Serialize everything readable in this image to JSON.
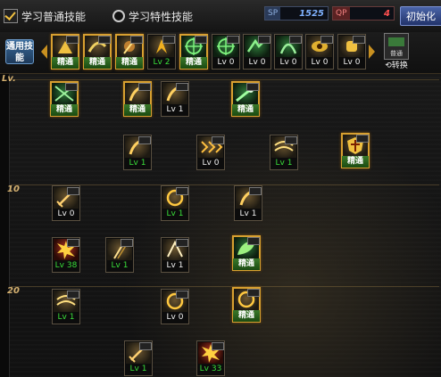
{
  "tabs": [
    {
      "label": "学习普通技能",
      "selected": true
    },
    {
      "label": "学习特性技能",
      "selected": false
    }
  ],
  "points": {
    "sp": {
      "label": "SP",
      "value": "1525"
    },
    "qp": {
      "label": "QP",
      "value": "4"
    }
  },
  "init_button": "初始化",
  "common": {
    "label": "通用技能",
    "items": [
      {
        "caption": "精通",
        "kind": "master",
        "icon": "strike-icon"
      },
      {
        "caption": "精通",
        "kind": "master",
        "icon": "kick-icon"
      },
      {
        "caption": "精通",
        "kind": "master",
        "icon": "throw-icon"
      },
      {
        "caption": "Lv 2",
        "kind": "lv",
        "icon": "phoenix-icon"
      },
      {
        "caption": "精通",
        "kind": "master",
        "icon": "crosshair-icon",
        "color": "green"
      },
      {
        "caption": "Lv 0",
        "kind": "lvw",
        "icon": "crosshair-icon",
        "color": "green"
      },
      {
        "caption": "Lv 0",
        "kind": "lvw",
        "icon": "dash-icon",
        "color": "green"
      },
      {
        "caption": "Lv 0",
        "kind": "lvw",
        "icon": "leap-icon",
        "color": "green"
      },
      {
        "caption": "Lv 0",
        "kind": "lvw",
        "icon": "eye-icon"
      },
      {
        "caption": "Lv 0",
        "kind": "lvw",
        "icon": "fist-icon"
      }
    ],
    "switch": {
      "box_label": "普通",
      "label": "转换"
    }
  },
  "level_labels": [
    "Lv.",
    "10",
    "20"
  ],
  "tree": [
    {
      "caption": "精通",
      "kind": "master",
      "icon": "grid-icon",
      "color": "green"
    },
    {
      "caption": "精通",
      "kind": "master",
      "icon": "slash-icon"
    },
    {
      "caption": "Lv 1",
      "kind": "lvw",
      "icon": "slash-icon"
    },
    {
      "caption": "精通",
      "kind": "master",
      "icon": "lunge-icon",
      "color": "green"
    },
    {
      "caption": "Lv 1",
      "kind": "lv",
      "icon": "slash-icon"
    },
    {
      "caption": "Lv 0",
      "kind": "lvw",
      "icon": "chevron-icon"
    },
    {
      "caption": "Lv 1",
      "kind": "lv",
      "icon": "wind-icon"
    },
    {
      "caption": "精通",
      "kind": "master",
      "icon": "shield-icon"
    },
    {
      "caption": "Lv 0",
      "kind": "lvw",
      "icon": "sword-icon"
    },
    {
      "caption": "Lv 1",
      "kind": "lv",
      "icon": "ring-icon"
    },
    {
      "caption": "Lv 1",
      "kind": "lvw",
      "icon": "slash-icon"
    },
    {
      "caption": "Lv 38",
      "kind": "lv",
      "icon": "burst-icon",
      "color": "red"
    },
    {
      "caption": "Lv 1",
      "kind": "lv",
      "icon": "blade-icon"
    },
    {
      "caption": "Lv 1",
      "kind": "lvw",
      "icon": "spike-icon"
    },
    {
      "caption": "精通",
      "kind": "master",
      "icon": "leaf-icon",
      "color": "green"
    },
    {
      "caption": "Lv 1",
      "kind": "lv",
      "icon": "wind-icon"
    },
    {
      "caption": "Lv 0",
      "kind": "lvw",
      "icon": "ring-icon"
    },
    {
      "caption": "精通",
      "kind": "master",
      "icon": "ring-icon"
    },
    {
      "caption": "Lv 1",
      "kind": "lv",
      "icon": "sword-icon"
    },
    {
      "caption": "Lv 33",
      "kind": "lv",
      "icon": "burst-icon",
      "color": "red"
    }
  ]
}
